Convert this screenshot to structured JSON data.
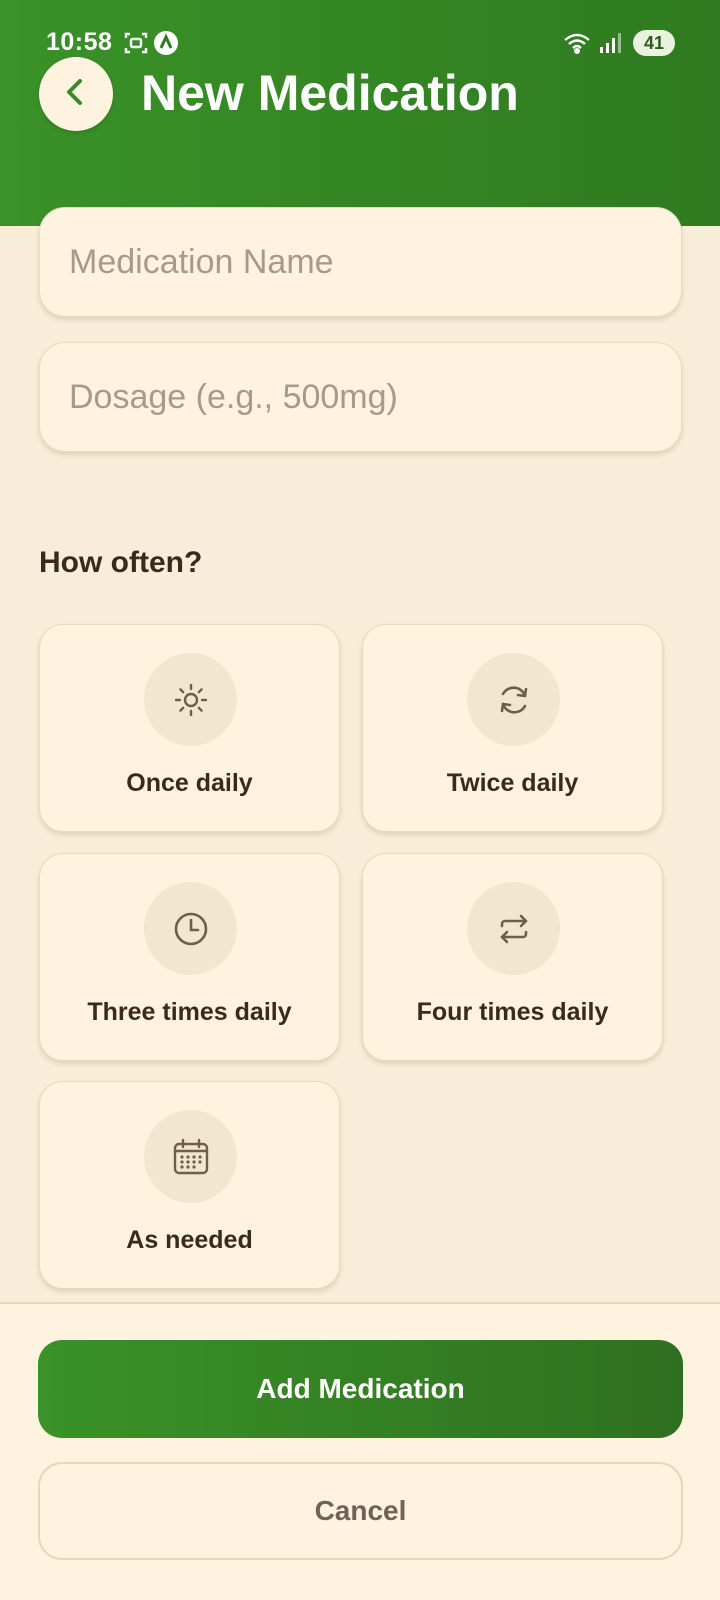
{
  "status_bar": {
    "time": "10:58",
    "battery": "41",
    "icons": [
      "screenshot-icon",
      "app-notification-icon",
      "wifi-icon",
      "signal-icon"
    ]
  },
  "header": {
    "back_icon": "chevron-left-icon",
    "title": "New Medication"
  },
  "form": {
    "name_placeholder": "Medication Name",
    "name_value": "",
    "dosage_placeholder": "Dosage (e.g., 500mg)",
    "dosage_value": ""
  },
  "frequency": {
    "label": "How often?",
    "options": [
      {
        "label": "Once daily",
        "icon": "sun-icon"
      },
      {
        "label": "Twice daily",
        "icon": "refresh-icon"
      },
      {
        "label": "Three times daily",
        "icon": "clock-icon"
      },
      {
        "label": "Four times daily",
        "icon": "repeat-icon"
      },
      {
        "label": "As needed",
        "icon": "calendar-icon"
      }
    ]
  },
  "actions": {
    "add_label": "Add Medication",
    "cancel_label": "Cancel"
  },
  "colors": {
    "primary_green": "#3A9228",
    "primary_green_dark": "#2F7A20",
    "background": "#F8EDD9",
    "card": "#FEF3DF",
    "text_dark": "#3B2A1A",
    "icon_brown": "#6E5E4C"
  }
}
